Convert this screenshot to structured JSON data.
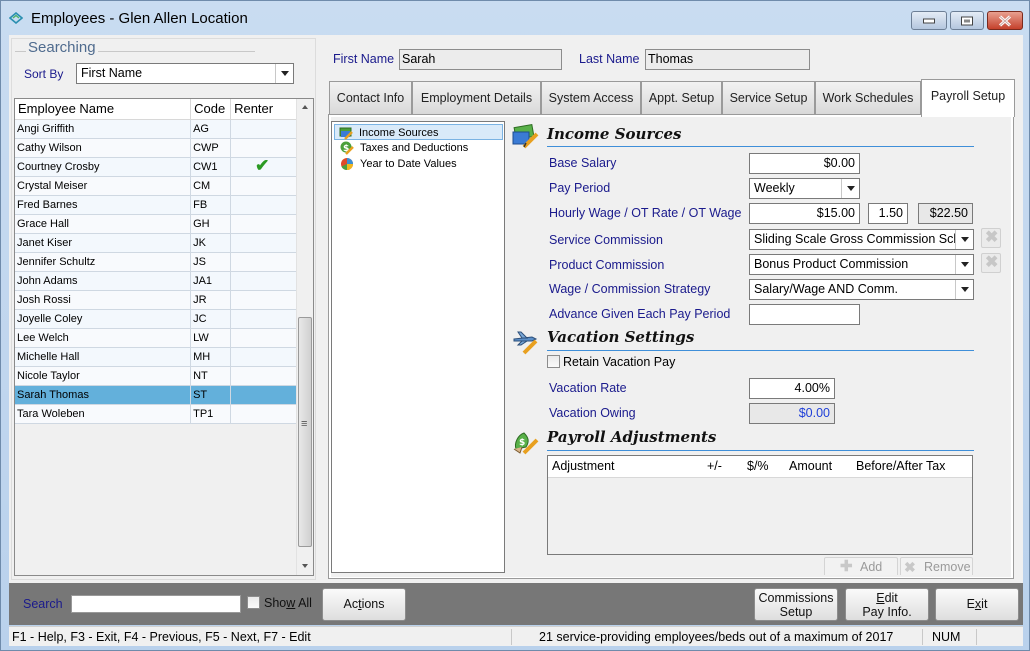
{
  "window": {
    "title": "Employees - Glen Allen Location",
    "controls": [
      "minimize",
      "maximize",
      "close"
    ]
  },
  "searching": {
    "group_title": "Searching",
    "sort_by_label": "Sort By",
    "sort_by_value": "First Name"
  },
  "employee_grid": {
    "columns": [
      "Employee Name",
      "Code",
      "Renter"
    ],
    "rows": [
      {
        "name": "Angi Griffith",
        "code": "AG",
        "renter": false
      },
      {
        "name": "Cathy Wilson",
        "code": "CWP",
        "renter": false
      },
      {
        "name": "Courtney Crosby",
        "code": "CW1",
        "renter": true
      },
      {
        "name": "Crystal Meiser",
        "code": "CM",
        "renter": false
      },
      {
        "name": "Fred Barnes",
        "code": "FB",
        "renter": false
      },
      {
        "name": "Grace Hall",
        "code": "GH",
        "renter": false
      },
      {
        "name": "Janet Kiser",
        "code": "JK",
        "renter": false
      },
      {
        "name": "Jennifer Schultz",
        "code": "JS",
        "renter": false
      },
      {
        "name": "John Adams",
        "code": "JA1",
        "renter": false
      },
      {
        "name": "Josh Rossi",
        "code": "JR",
        "renter": false
      },
      {
        "name": "Joyelle Coley",
        "code": "JC",
        "renter": false
      },
      {
        "name": "Lee Welch",
        "code": "LW",
        "renter": false
      },
      {
        "name": "Michelle Hall",
        "code": "MH",
        "renter": false
      },
      {
        "name": "Nicole Taylor",
        "code": "NT",
        "renter": false
      },
      {
        "name": "Sarah Thomas",
        "code": "ST",
        "renter": false,
        "selected": true
      },
      {
        "name": "Tara Woleben",
        "code": "TP1",
        "renter": false
      }
    ],
    "renter_check_glyph": "✔"
  },
  "header": {
    "first_name_label": "First Name",
    "first_name_value": "Sarah",
    "last_name_label": "Last Name",
    "last_name_value": "Thomas"
  },
  "tabs": [
    {
      "label": "Contact Info"
    },
    {
      "label": "Employment Details"
    },
    {
      "label": "System Access"
    },
    {
      "label": "Appt. Setup"
    },
    {
      "label": "Service Setup"
    },
    {
      "label": "Work Schedules"
    },
    {
      "label": "Payroll Setup",
      "active": true
    }
  ],
  "tree": {
    "items": [
      {
        "label": "Income Sources",
        "icon": "money-pencil-icon",
        "selected": true
      },
      {
        "label": "Taxes and Deductions",
        "icon": "dollar-pencil-icon"
      },
      {
        "label": "Year to Date Values",
        "icon": "pie-chart-icon"
      }
    ]
  },
  "income_sources": {
    "title": "Income Sources",
    "base_salary_label": "Base Salary",
    "base_salary_value": "$0.00",
    "pay_period_label": "Pay Period",
    "pay_period_value": "Weekly",
    "hourly_label": "Hourly Wage / OT Rate / OT Wage",
    "hourly_wage": "$15.00",
    "ot_rate": "1.50",
    "ot_wage": "$22.50",
    "service_commission_label": "Service Commission",
    "service_commission_value": "Sliding Scale Gross Commission Scl",
    "product_commission_label": "Product Commission",
    "product_commission_value": "Bonus Product Commission",
    "strategy_label": "Wage / Commission Strategy",
    "strategy_value": "Salary/Wage AND Comm.",
    "advance_label": "Advance Given Each Pay Period",
    "advance_value": ""
  },
  "vacation": {
    "title": "Vacation Settings",
    "retain_label": "Retain Vacation Pay",
    "retain_checked": false,
    "rate_label": "Vacation Rate",
    "rate_value": "4.00%",
    "owing_label": "Vacation Owing",
    "owing_value": "$0.00"
  },
  "adjustments": {
    "title": "Payroll Adjustments",
    "columns": [
      "Adjustment",
      "+/-",
      "$/%",
      "Amount",
      "Before/After Tax"
    ],
    "rows": [],
    "add_label": "Add",
    "remove_label": "Remove"
  },
  "bottom": {
    "search_label": "Search",
    "search_value": "",
    "show_all_label_pre": "Sho",
    "show_all_label_u": "w",
    "show_all_label_post": " All",
    "actions_pre": "Ac",
    "actions_u": "t",
    "actions_post": "ions",
    "commissions_line1": "Commissions",
    "commissions_line2": "Setup",
    "edit_u": "E",
    "edit_line1_post": "dit",
    "edit_line2": "Pay Info.",
    "exit_pre": "E",
    "exit_u": "x",
    "exit_post": "it"
  },
  "status": {
    "help": "F1 - Help, F3 - Exit, F4 - Previous, F5 - Next, F7 - Edit",
    "count": "21 service-providing employees/beds out of a maximum of 2017",
    "num": "NUM"
  }
}
